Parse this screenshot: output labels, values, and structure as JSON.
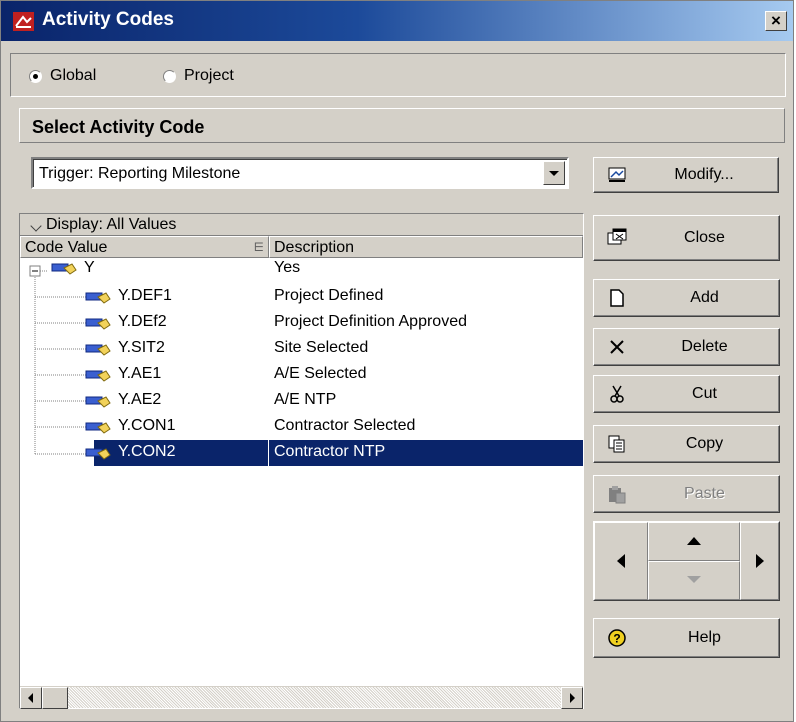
{
  "window": {
    "title": "Activity Codes",
    "close_glyph": "×",
    "title_icon": "activity-codes-app-icon"
  },
  "scope": {
    "options": [
      {
        "label": "Global",
        "selected": true
      },
      {
        "label": "Project",
        "selected": false
      }
    ]
  },
  "section": {
    "title": "Select Activity Code"
  },
  "code_select": {
    "value": "Trigger: Reporting Milestone"
  },
  "buttons": {
    "modify": "Modify...",
    "close": "Close",
    "add": "Add",
    "delete": "Delete",
    "cut": "Cut",
    "copy": "Copy",
    "paste": "Paste",
    "help": "Help"
  },
  "list": {
    "display_filter": "Display: All Values",
    "columns": {
      "code": "Code Value",
      "description": "Description"
    },
    "rows": [
      {
        "code": "Y",
        "description": "Yes",
        "level": 0,
        "expanded": true,
        "selected": false
      },
      {
        "code": "Y.DEF1",
        "description": "Project Defined",
        "level": 1,
        "selected": false
      },
      {
        "code": "Y.DEf2",
        "description": "Project Definition Approved",
        "level": 1,
        "selected": false
      },
      {
        "code": "Y.SIT2",
        "description": "Site Selected",
        "level": 1,
        "selected": false
      },
      {
        "code": "Y.AE1",
        "description": "A/E Selected",
        "level": 1,
        "selected": false
      },
      {
        "code": "Y.AE2",
        "description": "A/E NTP",
        "level": 1,
        "selected": false
      },
      {
        "code": "Y.CON1",
        "description": "Contractor Selected",
        "level": 1,
        "selected": false
      },
      {
        "code": "Y.CON2",
        "description": "Contractor NTP",
        "level": 1,
        "selected": true
      }
    ]
  },
  "colors": {
    "title_bar": "#0a246a",
    "selection": "#0a246a",
    "face": "#d4d0c8",
    "node_icon": "#3a5fd0"
  }
}
